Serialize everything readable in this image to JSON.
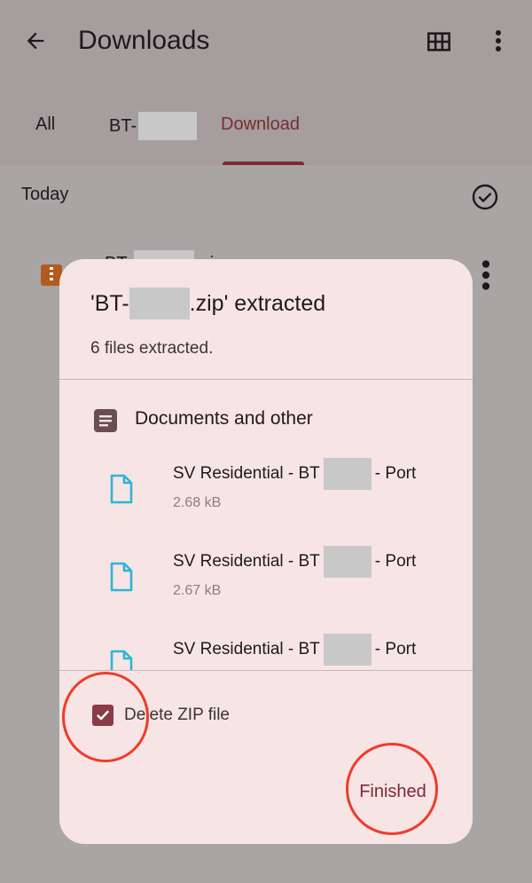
{
  "topbar": {
    "title": "Downloads",
    "icons": {
      "back": "arrow-back-icon",
      "grid": "grid-view-icon",
      "more": "more-vert-icon"
    }
  },
  "tabs": [
    {
      "label": "All"
    },
    {
      "label": "BT-"
    },
    {
      "label": "Download",
      "selected": true
    }
  ],
  "list": {
    "section": "Today",
    "row_name_prefix": "BT-",
    "row_name_suffix": ".zip"
  },
  "dialog": {
    "title_prefix": "'BT-",
    "title_suffix": ".zip' extracted",
    "subtitle": "6 files extracted.",
    "group_label": "Documents and other",
    "files": [
      {
        "name_prefix": "SV Residential - BT",
        "name_suffix": "- Port",
        "size": "2.68 kB"
      },
      {
        "name_prefix": "SV Residential - BT",
        "name_suffix": "- Port",
        "size": "2.67 kB"
      },
      {
        "name_prefix": "SV Residential - BT",
        "name_suffix": "- Port",
        "size": ""
      }
    ],
    "delete_zip_label": "Delete ZIP file",
    "delete_zip_checked": true,
    "finished_label": "Finished"
  },
  "colors": {
    "accent": "#7a2b34",
    "checkbox": "#8a3b46",
    "dialog_bg": "#f7e4e4",
    "file_icon": "#2bb6d8",
    "annotation": "#ef3b2a"
  }
}
